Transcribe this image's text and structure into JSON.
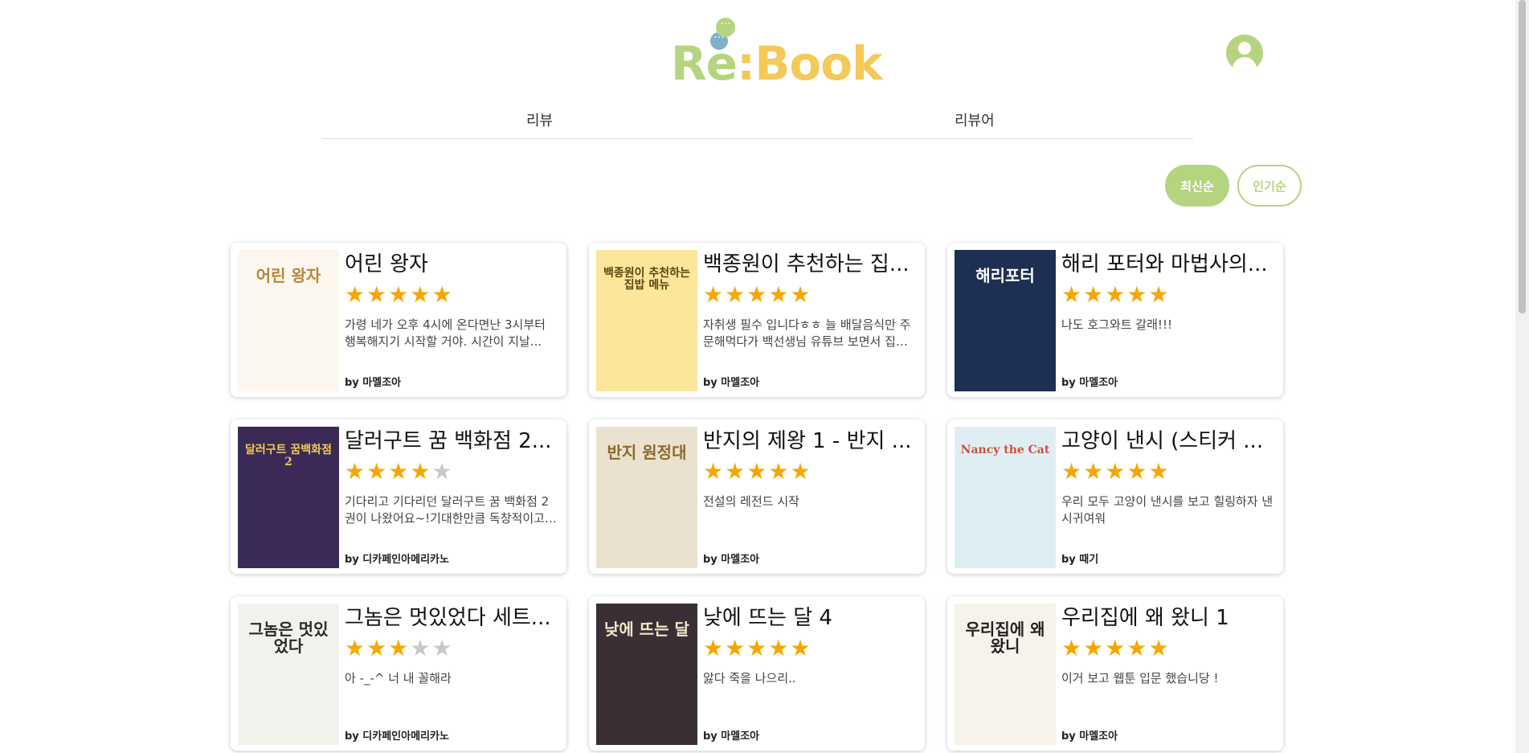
{
  "header": {
    "logo_re": "Re",
    "logo_colon": ":",
    "logo_book": "Book",
    "bubble_dots": "···"
  },
  "tabs": {
    "reviews": "리뷰",
    "reviewers": "리뷰어"
  },
  "sort": {
    "latest": "최신순",
    "popular": "인기순"
  },
  "colors": {
    "accent": "#b5d47f",
    "star": "#f5a700",
    "logo_yellow": "#f3c95a"
  },
  "cards": [
    {
      "title": "어린 왕자",
      "rating": 5,
      "review": "가령 네가 오후 4시에 온다면난 3시부터 행복해지기 시작할 거야. 시간이 지날...",
      "by": "by 마멜조아",
      "cover": "어린 왕자",
      "cover_bg": "#fbf7ee",
      "cover_fg": "#b7863a"
    },
    {
      "title": "백종원이 추천하는 집...",
      "rating": 5,
      "review": "자취생 필수 입니다ㅎㅎ 늘 배달음식만 주문해먹다가 백선생님 유튜브 보면서 집밥...",
      "by": "by 마멜조아",
      "cover": "백종원이 추천하는 집밥 메뉴",
      "cover_bg": "#fbe69a",
      "cover_fg": "#5a4510"
    },
    {
      "title": "해리 포터와 마법사의...",
      "rating": 5,
      "review": "나도 호그와트 갈래!!!",
      "by": "by 마멜조아",
      "cover": "해리포터",
      "cover_bg": "#1d2f52",
      "cover_fg": "#ffffff"
    },
    {
      "title": "달러구트 꿈 백화점 2...",
      "rating": 4,
      "review": "기다리고 기다리던 달러구트 꿈 백화점 2권이 나왔어요~!기대한만큼 독창적이고 ...",
      "by": "by 디카페인아메리카노",
      "cover": "달러구트 꿈백화점 2",
      "cover_bg": "#3a2a55",
      "cover_fg": "#f3c95a"
    },
    {
      "title": "반지의 제왕 1 - 반지 ...",
      "rating": 5,
      "review": "전설의 레전드 시작",
      "by": "by 마멜조아",
      "cover": "반지 원정대",
      "cover_bg": "#e9e2cf",
      "cover_fg": "#8a6b2a"
    },
    {
      "title": "고양이 낸시 (스티커 ...",
      "rating": 5,
      "review": "우리 모두 고양이 낸시를 보고 힐링하자 낸시귀여워",
      "by": "by 때기",
      "cover": "Nancy the Cat",
      "cover_bg": "#dfeef2",
      "cover_fg": "#c9503f"
    },
    {
      "title": "그놈은 멋있었다 세트...",
      "rating": 3,
      "review": "아 -_-^ 너 내 꼴해라",
      "by": "by 디카페인아메리카노",
      "cover": "그놈은 멋있었다",
      "cover_bg": "#f3f1ec",
      "cover_fg": "#2a2a2a"
    },
    {
      "title": "낮에 뜨는 달 4",
      "rating": 5,
      "review": "앓다 죽을 나으리..",
      "by": "by 마멜조아",
      "cover": "낮에 뜨는 달",
      "cover_bg": "#3b2f36",
      "cover_fg": "#f5e6c8"
    },
    {
      "title": "우리집에 왜 왔니 1",
      "rating": 5,
      "review": "이거 보고 웹툰 입문 했습니당 !",
      "by": "by 마멜조아",
      "cover": "우리집에 왜 왔니",
      "cover_bg": "#f7f3ea",
      "cover_fg": "#222222"
    }
  ]
}
